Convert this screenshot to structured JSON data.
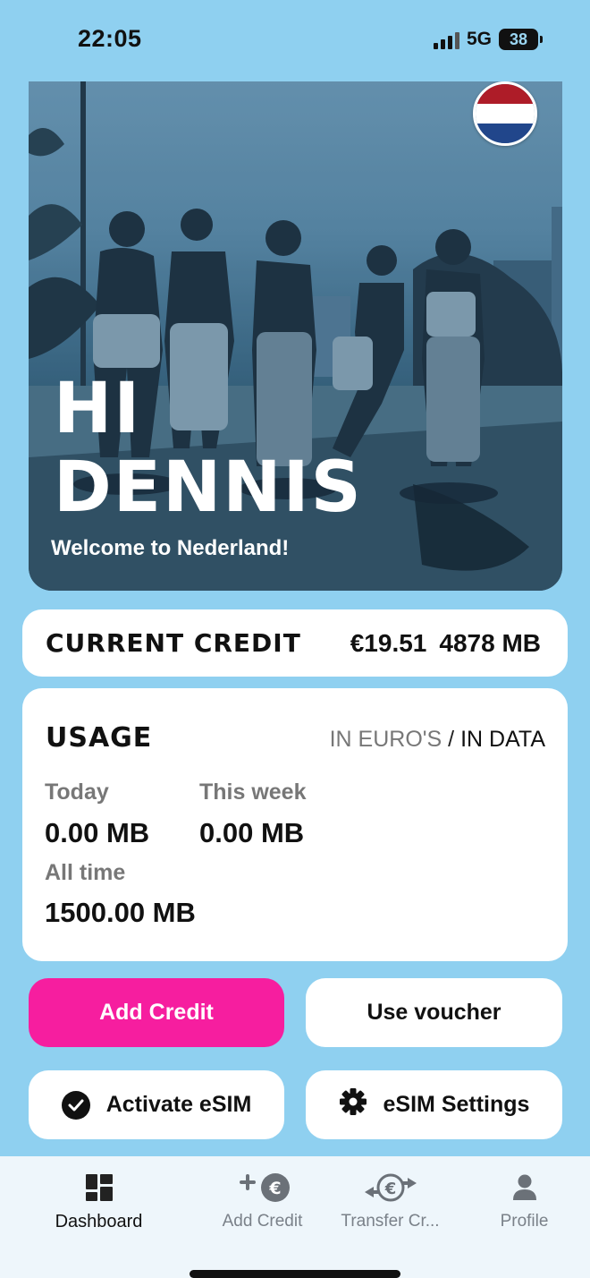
{
  "status": {
    "time": "22:05",
    "network": "5G",
    "battery": "38"
  },
  "hero": {
    "title_line1": "HI",
    "title_line2": "DENNIS",
    "subtitle": "Welcome to Nederland!",
    "flag_colors": [
      "#ae1c28",
      "#ffffff",
      "#21468b"
    ]
  },
  "credit": {
    "label": "CURRENT CREDIT",
    "amount": "€19.51",
    "data": "4878 MB"
  },
  "usage": {
    "title": "USAGE",
    "toggle_euros": "IN EURO'S",
    "toggle_separator": "/",
    "toggle_data": "IN DATA",
    "today_label": "Today",
    "today_value": "0.00 MB",
    "week_label": "This week",
    "week_value": "0.00 MB",
    "all_label": "All time",
    "all_value": "1500.00 MB"
  },
  "actions": {
    "add_credit": "Add Credit",
    "use_voucher": "Use voucher",
    "activate_esim": "Activate eSIM",
    "esim_settings": "eSIM Settings"
  },
  "tabs": [
    {
      "label": "Dashboard",
      "icon": "dashboard-icon",
      "active": true
    },
    {
      "label": "Add Credit",
      "icon": "add-euro-icon",
      "active": false
    },
    {
      "label": "Transfer Cr...",
      "icon": "transfer-euro-icon",
      "active": false
    },
    {
      "label": "Profile",
      "icon": "person-icon",
      "active": false
    }
  ],
  "colors": {
    "background": "#8fd0f0",
    "accent_pink": "#f61e9f"
  }
}
